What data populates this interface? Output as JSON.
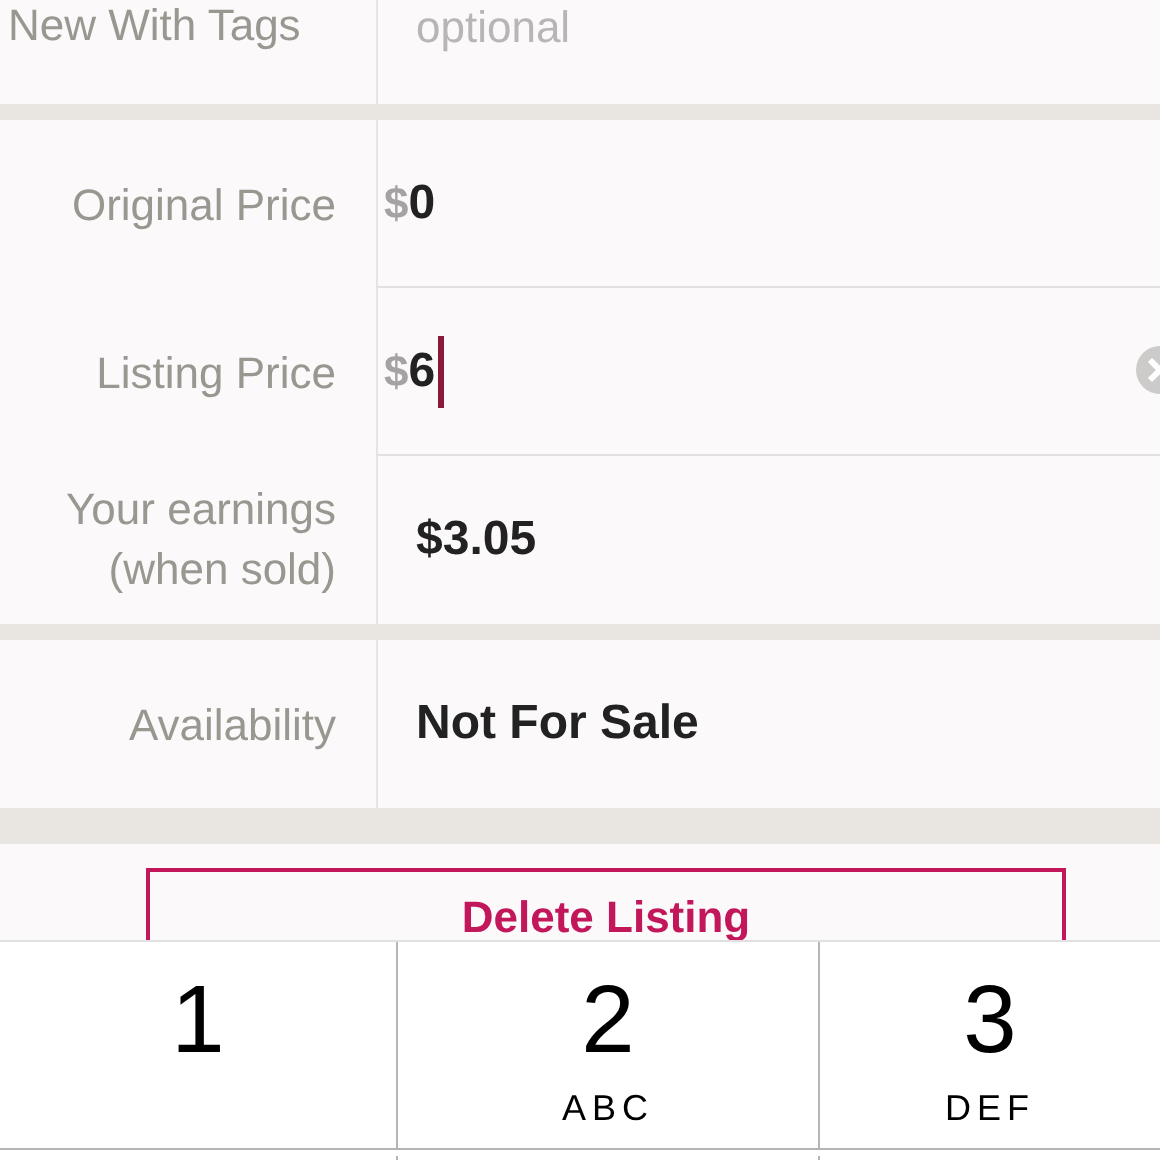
{
  "condition_row": {
    "label": "New With Tags",
    "placeholder": "optional"
  },
  "price_fields": [
    {
      "label": "Original Price",
      "currency": "$",
      "value": "0",
      "focused": false
    },
    {
      "label": "Listing Price",
      "currency": "$",
      "value": "6",
      "focused": true
    }
  ],
  "earnings": {
    "label_lines": [
      "Your earnings",
      "(when sold)"
    ],
    "value": "$3.05"
  },
  "availability": {
    "label": "Availability",
    "value": "Not For Sale"
  },
  "delete_button": "Delete Listing",
  "keypad": [
    {
      "digit": "1"
    },
    {
      "digit": "2",
      "letters": "ABC"
    },
    {
      "digit": "3",
      "letters": "DEF"
    }
  ]
}
